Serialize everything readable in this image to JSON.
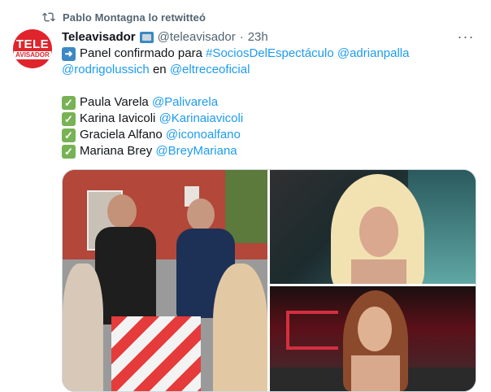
{
  "retweet": {
    "text": "Pablo Montagna lo retwitteó"
  },
  "avatar": {
    "line1": "TELE",
    "line2": "AVISADOR"
  },
  "tweet": {
    "name": "Teleavisador",
    "handle": "@teleavisador",
    "separator": "·",
    "time": "23h",
    "more": "···",
    "line1": {
      "text": "Panel confirmado para ",
      "link1": "#SociosDelEspectáculo",
      "link2": "@adrianpalla"
    },
    "line2": {
      "link1": "@rodrigolussich",
      "text": " en ",
      "link2": "@eltreceoficial"
    },
    "panel": [
      {
        "name": "Paula Varela",
        "handle": "@Palivarela"
      },
      {
        "name": "Karina Iavicoli",
        "handle": "@Karinaiavicoli"
      },
      {
        "name": "Graciela Alfano",
        "handle": "@iconoalfano"
      },
      {
        "name": "Mariana Brey",
        "handle": "@BreyMariana"
      }
    ]
  },
  "icons": {
    "retweet": "retweet-icon",
    "tv": "tv-emoji",
    "arrow": "right-arrow-emoji",
    "check": "check-mark-emoji",
    "more": "more-icon"
  },
  "colors": {
    "link": "#1d9bf0",
    "secondary": "#536471",
    "brand": "#e0242c",
    "check": "#77b255"
  }
}
